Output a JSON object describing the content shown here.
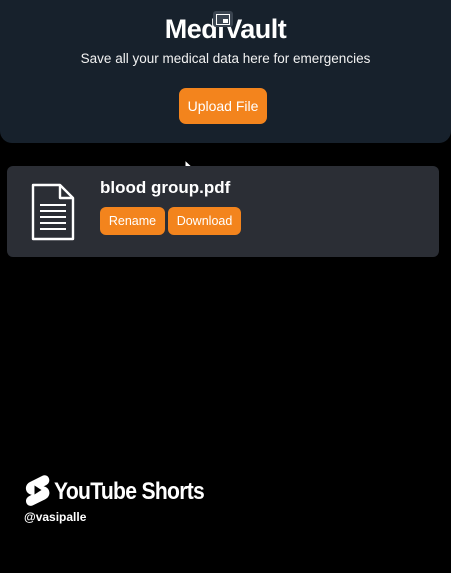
{
  "header": {
    "app_title": "MediVault",
    "tagline": "Save all your medical data here for emergencies",
    "upload_label": "Upload File"
  },
  "files": [
    {
      "name": "blood group.pdf",
      "rename_label": "Rename",
      "download_label": "Download"
    }
  ],
  "overlay": {
    "brand": "YouTube Shorts",
    "handle": "@vasipalle"
  },
  "icons": {
    "pip": "picture-in-picture-icon",
    "cursor": "mouse-pointer-icon",
    "file": "document-icon",
    "shorts": "youtube-shorts-icon"
  },
  "colors": {
    "accent": "#f3841d",
    "header_bg": "#17212c",
    "card_bg": "#2b2e35",
    "page_bg": "#000000"
  }
}
